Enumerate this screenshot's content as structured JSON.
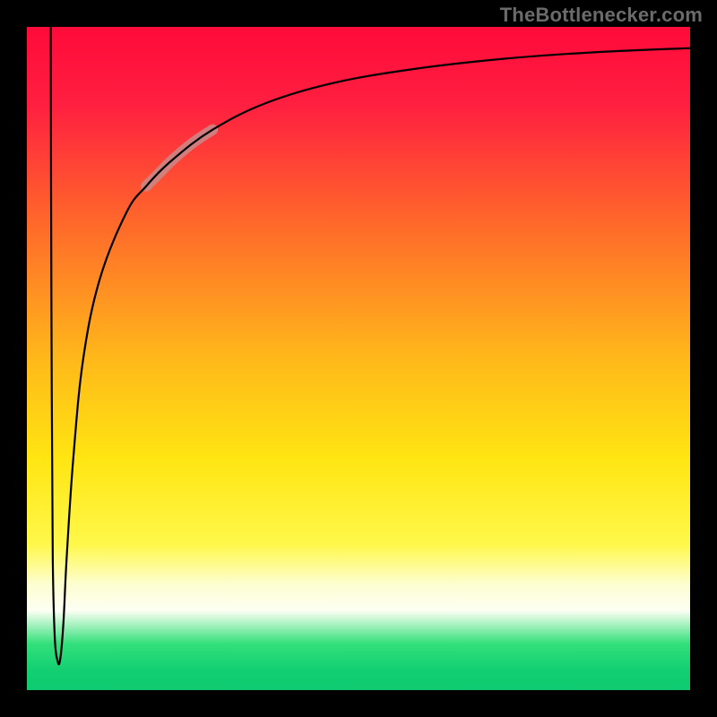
{
  "watermark": "TheBottlenecker.com",
  "chart_data": {
    "type": "line",
    "title": "",
    "xlabel": "",
    "ylabel": "",
    "xlim": [
      0,
      100
    ],
    "ylim": [
      0,
      100
    ],
    "gradient_stops": [
      {
        "offset": 0.0,
        "color": "#ff0a3a"
      },
      {
        "offset": 0.12,
        "color": "#ff2040"
      },
      {
        "offset": 0.3,
        "color": "#ff6a2a"
      },
      {
        "offset": 0.5,
        "color": "#ffb81a"
      },
      {
        "offset": 0.65,
        "color": "#ffe512"
      },
      {
        "offset": 0.78,
        "color": "#fff84a"
      },
      {
        "offset": 0.84,
        "color": "#fdfed0"
      },
      {
        "offset": 0.88,
        "color": "#fdfff3"
      },
      {
        "offset": 0.93,
        "color": "#33e07a"
      },
      {
        "offset": 0.97,
        "color": "#12cf72"
      },
      {
        "offset": 1.0,
        "color": "#0fca70"
      }
    ],
    "series": [
      {
        "name": "bottleneck-curve",
        "stroke": "#000000",
        "stroke_width": 2.2,
        "points": [
          {
            "x": 3.6,
            "y": 100.0
          },
          {
            "x": 3.65,
            "y": 75.0
          },
          {
            "x": 3.75,
            "y": 45.0
          },
          {
            "x": 3.9,
            "y": 20.0
          },
          {
            "x": 4.2,
            "y": 8.0
          },
          {
            "x": 4.6,
            "y": 4.5
          },
          {
            "x": 5.0,
            "y": 4.5
          },
          {
            "x": 5.5,
            "y": 10.0
          },
          {
            "x": 6.0,
            "y": 20.0
          },
          {
            "x": 7.0,
            "y": 35.0
          },
          {
            "x": 8.5,
            "y": 50.0
          },
          {
            "x": 11.0,
            "y": 62.0
          },
          {
            "x": 15.0,
            "y": 72.0
          },
          {
            "x": 18.0,
            "y": 76.0
          },
          {
            "x": 22.0,
            "y": 80.0
          },
          {
            "x": 28.0,
            "y": 84.5
          },
          {
            "x": 36.0,
            "y": 88.5
          },
          {
            "x": 46.0,
            "y": 91.5
          },
          {
            "x": 58.0,
            "y": 93.6
          },
          {
            "x": 72.0,
            "y": 95.2
          },
          {
            "x": 86.0,
            "y": 96.2
          },
          {
            "x": 100.0,
            "y": 96.8
          }
        ]
      },
      {
        "name": "highlight-segment",
        "stroke": "#c98a8a",
        "stroke_opacity": 0.85,
        "stroke_width": 12,
        "points": [
          {
            "x": 18.0,
            "y": 76.0
          },
          {
            "x": 20.0,
            "y": 78.0
          },
          {
            "x": 22.0,
            "y": 80.0
          },
          {
            "x": 25.0,
            "y": 82.5
          },
          {
            "x": 28.0,
            "y": 84.5
          }
        ]
      }
    ]
  }
}
